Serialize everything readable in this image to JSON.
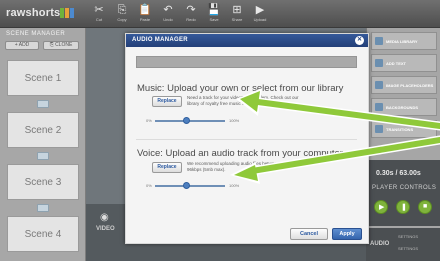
{
  "app": {
    "logo_text": "rawshorts",
    "logo_colors": [
      "#6fb23b",
      "#e8a13a",
      "#4c8ad0"
    ]
  },
  "toolbar": {
    "buttons": [
      {
        "icon": "cut-icon",
        "glyph": "✂",
        "label": "Cut"
      },
      {
        "icon": "copy-icon",
        "glyph": "⎘",
        "label": "Copy"
      },
      {
        "icon": "paste-icon",
        "glyph": "📋",
        "label": "Paste"
      },
      {
        "icon": "undo-icon",
        "glyph": "↶",
        "label": "Undo"
      },
      {
        "icon": "redo-icon",
        "glyph": "↷",
        "label": "Redo"
      },
      {
        "icon": "save-icon",
        "glyph": "💾",
        "label": "Save"
      },
      {
        "icon": "share-icon",
        "glyph": "⊞",
        "label": "Share"
      },
      {
        "icon": "upload-icon",
        "glyph": "▶",
        "label": "Upload"
      }
    ]
  },
  "scene_manager": {
    "title": "SCENE MANAGER",
    "add_label": "ADD",
    "clone_label": "CLONE",
    "scenes": [
      "Scene 1",
      "Scene 2",
      "Scene 3",
      "Scene 4"
    ]
  },
  "stage": {
    "video_label": "VIDEO"
  },
  "right_panel": {
    "items": [
      "MEDIA LIBRARY",
      "ADD TEXT",
      "IMAGE PLACEHOLDERS",
      "BACKGROUNDS",
      "TRANSITIONS"
    ],
    "time_display": "0.30s / 63.00s",
    "player_controls_title": "PLAYER CONTROLS",
    "audio_label": "AUDIO",
    "audio_options": [
      "SETTINGS",
      "SETTINGS"
    ]
  },
  "modal": {
    "title": "AUDIO MANAGER",
    "close_glyph": "✕",
    "music": {
      "title": "Music: Upload your own or select from our library",
      "replace_label": "Replace",
      "description": "Need a track for your video? No problem. Check out our library of royalty free music or upload your own.",
      "min_label": "0%",
      "max_label": "100%",
      "volume": 0.45
    },
    "voice": {
      "title": "Voice: Upload an audio track from your computer",
      "replace_label": "Replace",
      "description": "We recommend uploading audio files between 64kbps and 96kbps (5mb max).",
      "min_label": "0%",
      "max_label": "100%",
      "volume": 0.45
    },
    "cancel_label": "Cancel",
    "apply_label": "Apply"
  },
  "colors": {
    "accent": "#2d4a85",
    "arrow": "#8fc93a",
    "play": "#7fb33c"
  }
}
